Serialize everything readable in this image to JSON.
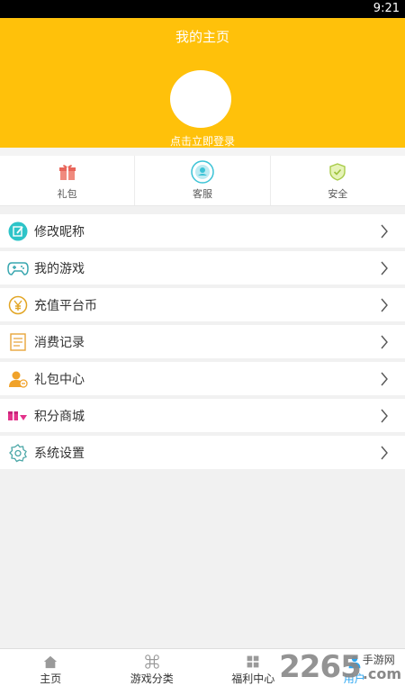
{
  "status": {
    "time": "9:21"
  },
  "header": {
    "title": "我的主页",
    "login": "点击立即登录",
    "bg_color": "#ffc10a"
  },
  "quick": [
    {
      "label": "礼包",
      "icon": "gift-icon"
    },
    {
      "label": "客服",
      "icon": "customer-service-icon"
    },
    {
      "label": "安全",
      "icon": "shield-check-icon"
    }
  ],
  "menu": [
    {
      "label": "修改昵称",
      "icon": "edit-icon"
    },
    {
      "label": "我的游戏",
      "icon": "gamepad-icon"
    },
    {
      "label": "充值平台币",
      "icon": "yen-coin-icon"
    },
    {
      "label": "消费记录",
      "icon": "record-list-icon"
    },
    {
      "label": "礼包中心",
      "icon": "gift-center-user-icon"
    },
    {
      "label": "积分商城",
      "icon": "points-mall-icon"
    },
    {
      "label": "系统设置",
      "icon": "settings-gear-icon"
    }
  ],
  "tabs": [
    {
      "label": "主页",
      "icon": "home-icon"
    },
    {
      "label": "游戏分类",
      "icon": "command-icon"
    },
    {
      "label": "福利中心",
      "icon": "grid-icon"
    },
    {
      "label": "用户",
      "icon": "user-icon",
      "active": true
    }
  ],
  "watermark": {
    "number": "2265",
    "text": "手游网",
    "suffix": ".com"
  },
  "colors": {
    "accent": "#ffc10a",
    "active_tab": "#2aa6f2"
  }
}
